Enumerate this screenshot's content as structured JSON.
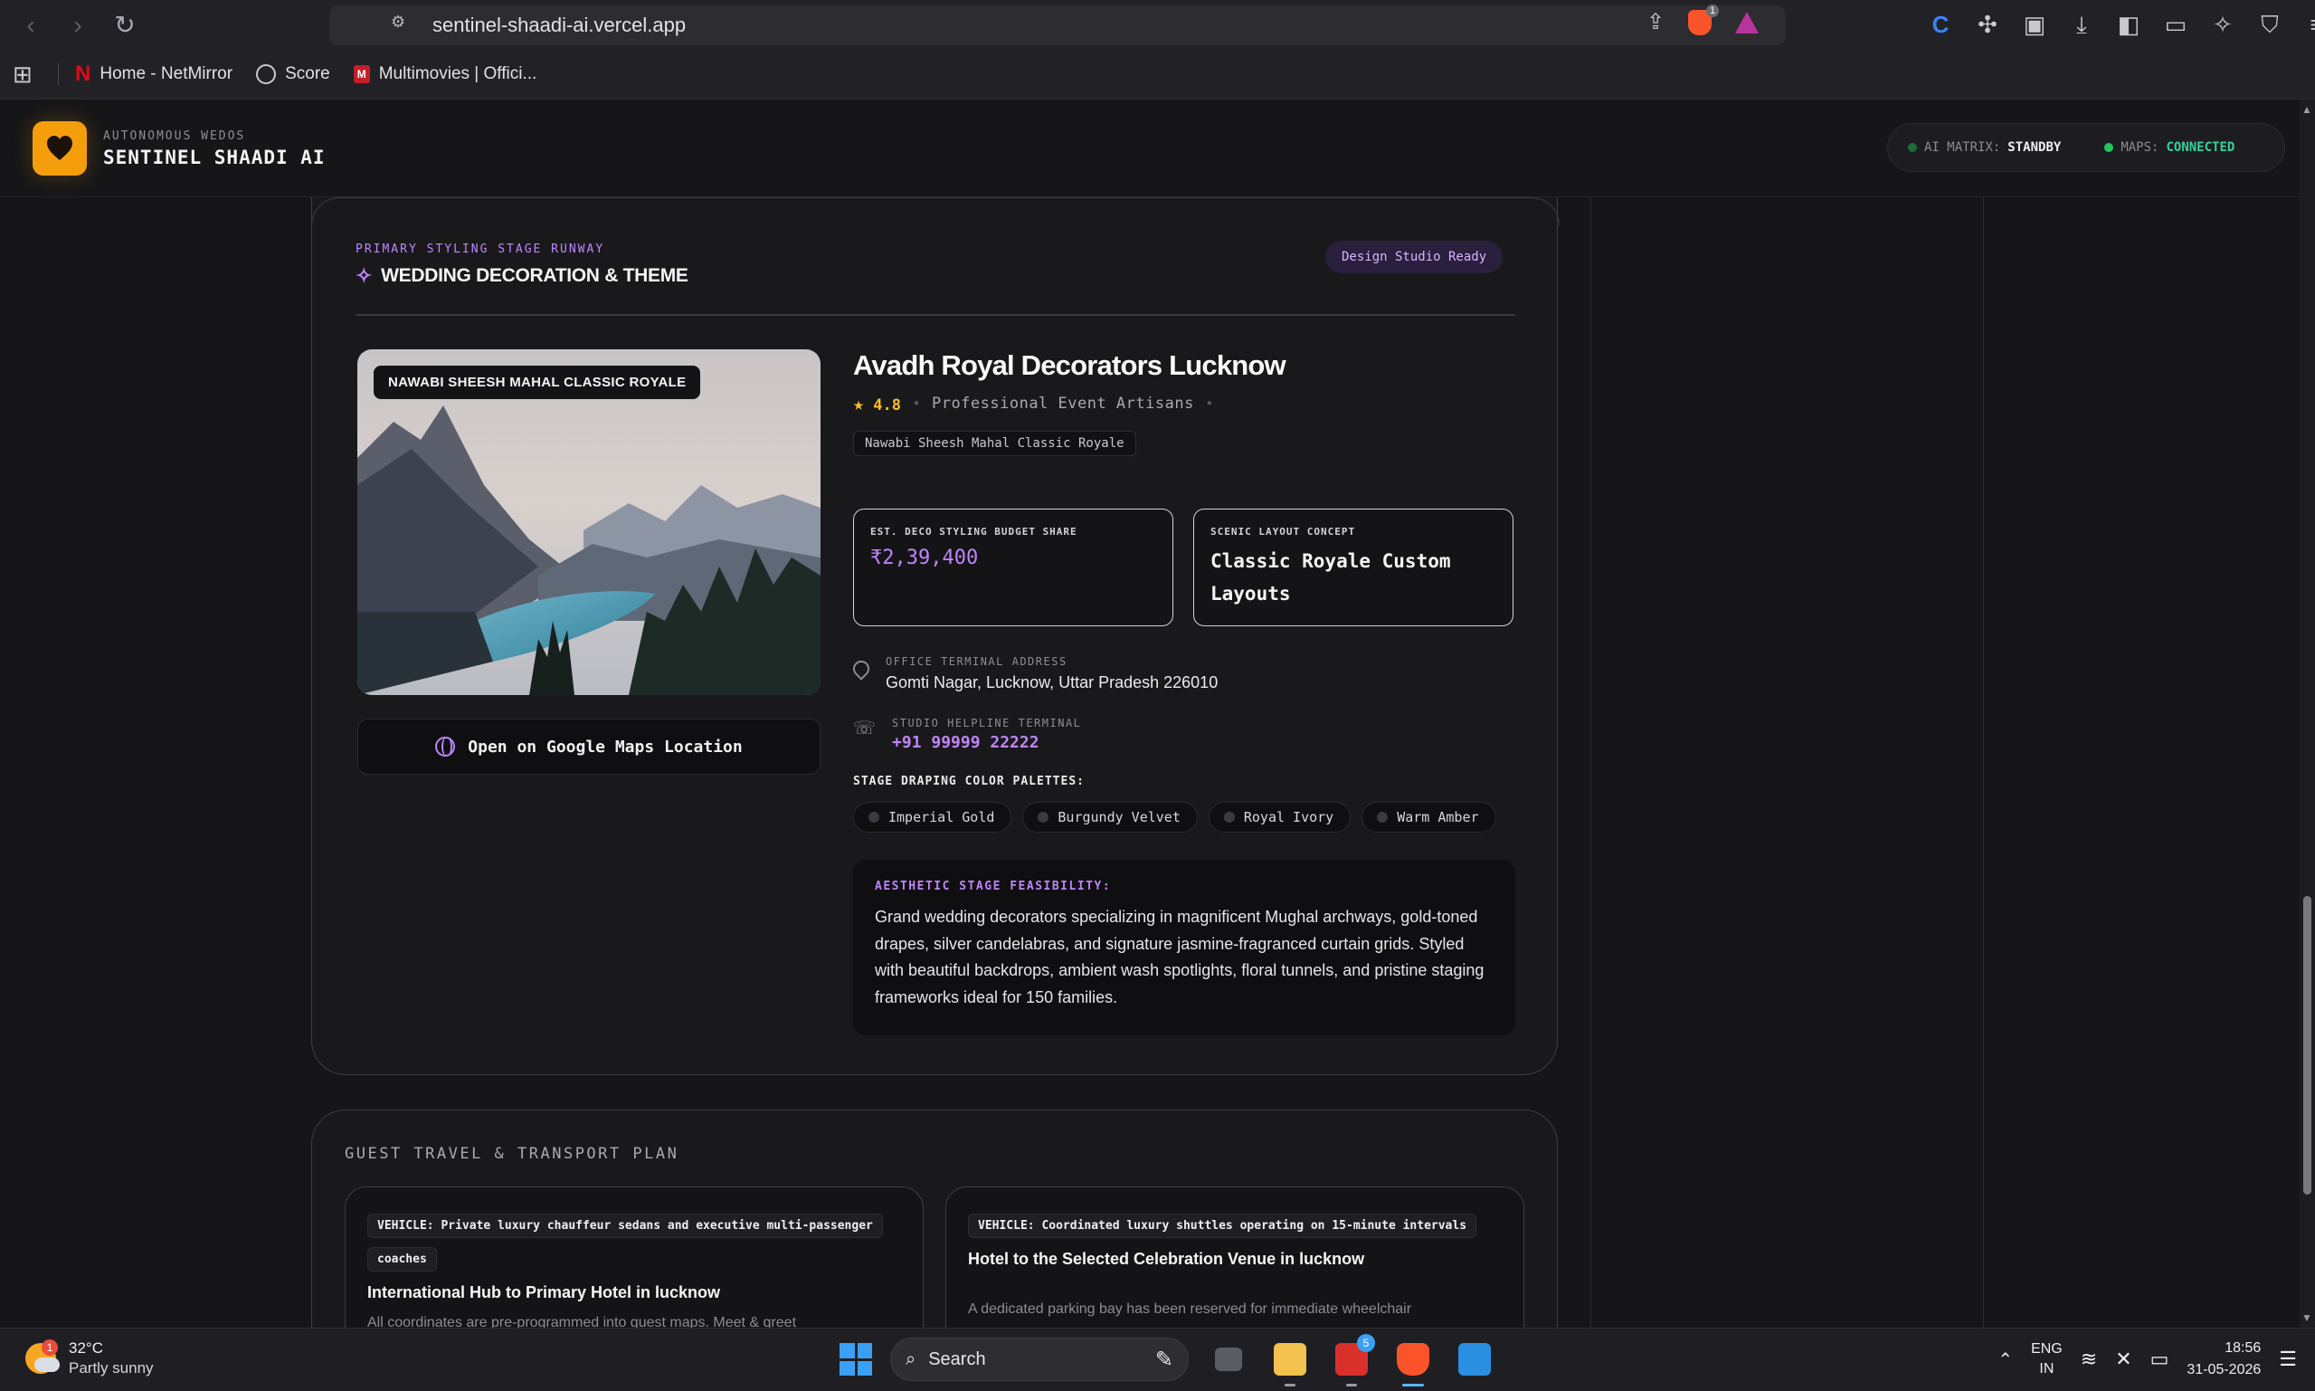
{
  "browser": {
    "url": "sentinel-shaadi-ai.vercel.app",
    "bookmarks": [
      {
        "label": "Home - NetMirror"
      },
      {
        "label": "Score"
      },
      {
        "label": "Multimovies | Offici..."
      }
    ],
    "shield_count": "1"
  },
  "header": {
    "brand_subtitle": "AUTONOMOUS WEDOS",
    "brand_title": "SENTINEL SHAADI AI",
    "status": {
      "ai_label": "AI MATRIX:",
      "ai_value": "STANDBY",
      "maps_label": "MAPS:",
      "maps_value": "CONNECTED"
    }
  },
  "decoration": {
    "eyebrow": "PRIMARY STYLING STAGE RUNWAY",
    "title": "WEDDING DECORATION & THEME",
    "badge": "Design Studio Ready",
    "photo_tag": "NAWABI SHEESH MAHAL CLASSIC ROYALE",
    "maps_button": "Open on Google Maps Location",
    "vendor_name": "Avadh Royal Decorators Lucknow",
    "rating": "4.8",
    "vendor_type": "Professional Event Artisans",
    "theme_chip": "Nawabi Sheesh Mahal Classic Royale",
    "budget_label": "EST. DECO STYLING BUDGET SHARE",
    "budget_value": "₹2,39,400",
    "concept_label": "SCENIC LAYOUT CONCEPT",
    "concept_value": "Classic Royale Custom Layouts",
    "address_label": "OFFICE TERMINAL ADDRESS",
    "address_value": "Gomti Nagar, Lucknow, Uttar Pradesh 226010",
    "phone_label": "STUDIO HELPLINE TERMINAL",
    "phone_value": "+91 99999 22222",
    "palette_label": "STAGE DRAPING COLOR PALETTES:",
    "palettes": [
      "Imperial Gold",
      "Burgundy Velvet",
      "Royal Ivory",
      "Warm Amber"
    ],
    "feasibility_label": "AESTHETIC STAGE FEASIBILITY:",
    "feasibility_text": "Grand wedding decorators specializing in magnificent Mughal archways, gold-toned drapes, silver candelabras, and signature jasmine-fragranced curtain grids. Styled with beautiful backdrops, ambient wash spotlights, floral tunnels, and pristine staging frameworks ideal for 150 families."
  },
  "travel": {
    "title": "GUEST TRAVEL & TRANSPORT PLAN",
    "routes": [
      {
        "vehicle": "VEHICLE: Private luxury chauffeur sedans and executive multi-passenger coaches",
        "title": "International Hub to Primary Hotel in lucknow",
        "desc": "All coordinates are pre-programmed into guest maps. Meet & greet"
      },
      {
        "vehicle": "VEHICLE: Coordinated luxury shuttles operating on 15-minute intervals",
        "title": "Hotel to the Selected Celebration Venue in lucknow",
        "desc": "A dedicated parking bay has been reserved for immediate wheelchair"
      }
    ]
  },
  "taskbar": {
    "temp": "32°C",
    "weather": "Partly sunny",
    "weather_badge": "1",
    "search": "Search",
    "app_badge": "5",
    "lang_1": "ENG",
    "lang_2": "IN",
    "time": "18:56",
    "date": "31-05-2026"
  }
}
